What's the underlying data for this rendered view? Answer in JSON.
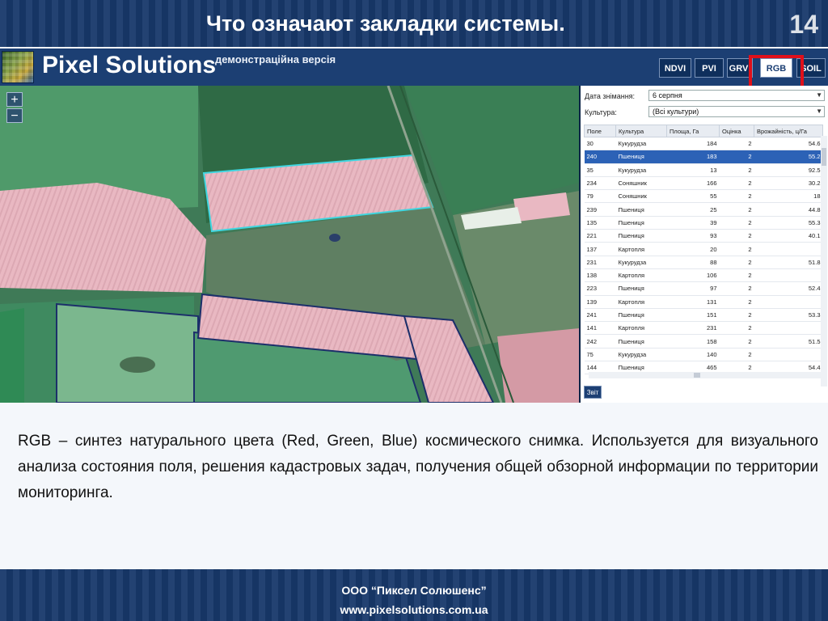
{
  "slide": {
    "title": "Что означают закладки системы.",
    "number": "14"
  },
  "app": {
    "brand": "Pixel Solutions",
    "demo_label": "демонстраційна версія",
    "tabs": [
      "NDVI",
      "PVI",
      "GRVI",
      "RGB",
      "SOIL"
    ],
    "active_tab": "RGB"
  },
  "zoom": {
    "in": "+",
    "out": "−"
  },
  "filters": {
    "date_label": "Дата знімання:",
    "date_value": "6 серпня",
    "culture_label": "Культура:",
    "culture_value": "(Всі культури)"
  },
  "table": {
    "headers": [
      "Поле",
      "Культура",
      "Площа, Га",
      "Оцінка",
      "Врожайність, ц/Га"
    ],
    "rows": [
      [
        "30",
        "Кукурудза",
        "184",
        "2",
        "54.6"
      ],
      [
        "240",
        "Пшениця",
        "183",
        "2",
        "55.2"
      ],
      [
        "35",
        "Кукурудза",
        "13",
        "2",
        "92.5"
      ],
      [
        "234",
        "Соняшник",
        "166",
        "2",
        "30.2"
      ],
      [
        "79",
        "Соняшник",
        "55",
        "2",
        "18"
      ],
      [
        "239",
        "Пшениця",
        "25",
        "2",
        "44.8"
      ],
      [
        "135",
        "Пшениця",
        "39",
        "2",
        "55.3"
      ],
      [
        "221",
        "Пшениця",
        "93",
        "2",
        "40.1"
      ],
      [
        "137",
        "Картопля",
        "20",
        "2",
        ""
      ],
      [
        "231",
        "Кукурудза",
        "88",
        "2",
        "51.8"
      ],
      [
        "138",
        "Картопля",
        "106",
        "2",
        ""
      ],
      [
        "223",
        "Пшениця",
        "97",
        "2",
        "52.4"
      ],
      [
        "139",
        "Картопля",
        "131",
        "2",
        ""
      ],
      [
        "241",
        "Пшениця",
        "151",
        "2",
        "53.3"
      ],
      [
        "141",
        "Картопля",
        "231",
        "2",
        ""
      ],
      [
        "242",
        "Пшениця",
        "158",
        "2",
        "51.5"
      ],
      [
        "75",
        "Кукурудза",
        "140",
        "2",
        ""
      ],
      [
        "144",
        "Пшениця",
        "465",
        "2",
        "54.4"
      ]
    ],
    "selected_row": 1,
    "export_label": "Звіт"
  },
  "description": "RGB –  синтез натурального цвета (Red, Green, Blue) космического снимка. Используется для визуального анализа состояния поля, решения кадастровых задач, получения общей обзорной информации по территории мониторинга.",
  "footer": {
    "company": "ООО “Пиксел Солюшенс”",
    "url": "www.pixelsolutions.com.ua"
  },
  "colors": {
    "header_bg": "#17386a",
    "highlight": "#e0101a",
    "selected_row": "#2c62b6",
    "field_pink": "#e9b8c2",
    "field_boundary": "#3fd6e0"
  }
}
